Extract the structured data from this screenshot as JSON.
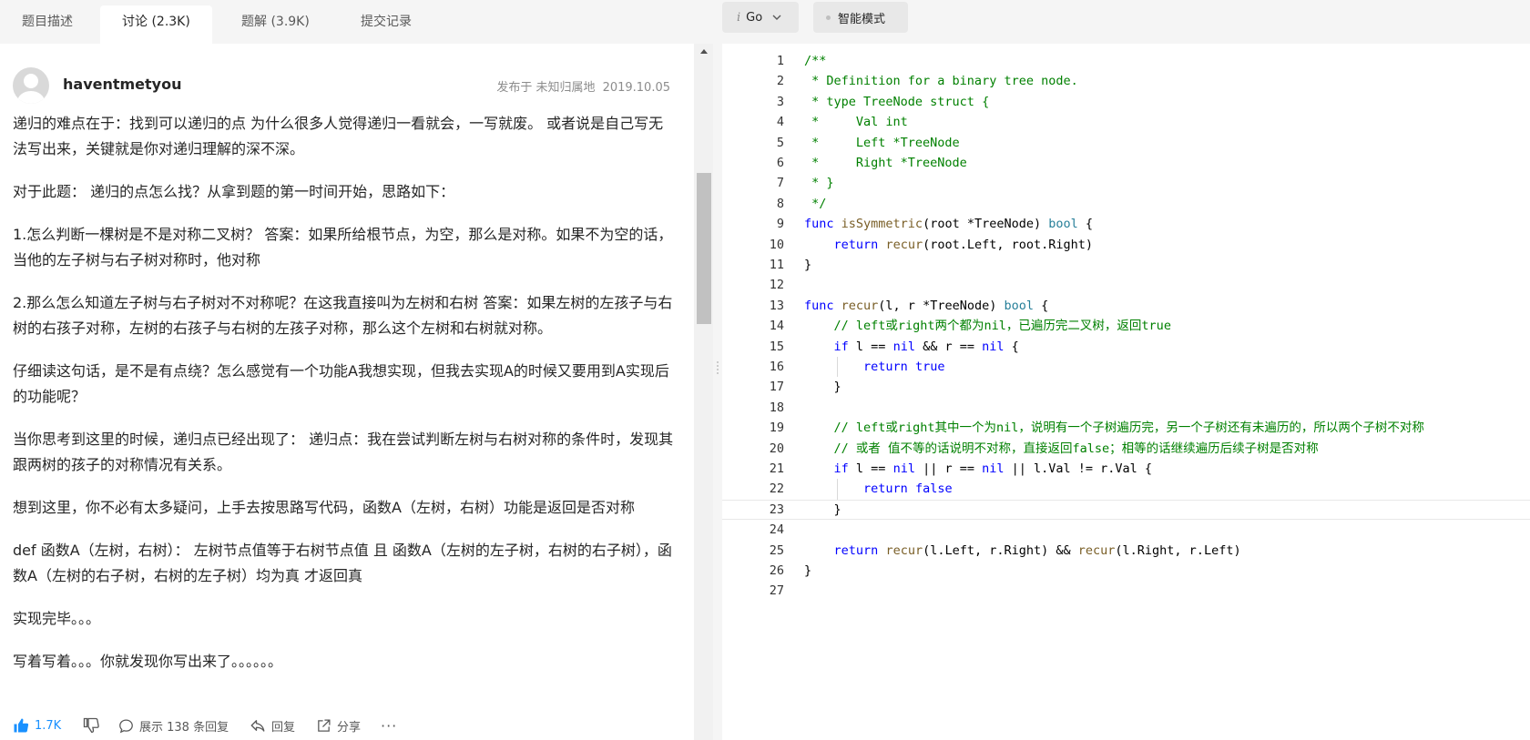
{
  "tabs": [
    {
      "label": "题目描述",
      "active": false
    },
    {
      "label": "讨论 (2.3K)",
      "active": true
    },
    {
      "label": "题解 (3.9K)",
      "active": false
    },
    {
      "label": "提交记录",
      "active": false
    }
  ],
  "post": {
    "author": "haventmetyou",
    "meta_prefix": "发布于 未知归属地",
    "date": "2019.10.05",
    "paragraphs": [
      "递归的难点在于：找到可以递归的点 为什么很多人觉得递归一看就会，一写就废。 或者说是自己写无法写出来，关键就是你对递归理解的深不深。",
      "对于此题： 递归的点怎么找？从拿到题的第一时间开始，思路如下：",
      "1.怎么判断一棵树是不是对称二叉树？ 答案：如果所给根节点，为空，那么是对称。如果不为空的话，当他的左子树与右子树对称时，他对称",
      "2.那么怎么知道左子树与右子树对不对称呢？在这我直接叫为左树和右树 答案：如果左树的左孩子与右树的右孩子对称，左树的右孩子与右树的左孩子对称，那么这个左树和右树就对称。",
      "仔细读这句话，是不是有点绕？怎么感觉有一个功能A我想实现，但我去实现A的时候又要用到A实现后的功能呢？",
      "当你思考到这里的时候，递归点已经出现了： 递归点：我在尝试判断左树与右树对称的条件时，发现其跟两树的孩子的对称情况有关系。",
      "想到这里，你不必有太多疑问，上手去按思路写代码，函数A（左树，右树）功能是返回是否对称",
      "def 函数A（左树，右树）： 左树节点值等于右树节点值 且 函数A（左树的左子树，右树的右子树），函数A（左树的右子树，右树的左子树）均为真 才返回真",
      "实现完毕。。。",
      "写着写着。。。你就发现你写出来了。。。。。。"
    ],
    "actions": {
      "like": "1.7K",
      "replies": "展示 138 条回复",
      "reply": "回复",
      "share": "分享",
      "more": "···"
    }
  },
  "toolbar": {
    "lang_icon": "i",
    "lang": "Go",
    "smart_mode": "智能模式"
  },
  "editor": {
    "current_line": 23,
    "lines": [
      [
        {
          "t": "/**",
          "c": "com"
        }
      ],
      [
        {
          "t": " * Definition for a binary tree node.",
          "c": "com"
        }
      ],
      [
        {
          "t": " * type TreeNode struct {",
          "c": "com"
        }
      ],
      [
        {
          "t": " *     Val int",
          "c": "com"
        }
      ],
      [
        {
          "t": " *     Left *TreeNode",
          "c": "com"
        }
      ],
      [
        {
          "t": " *     Right *TreeNode",
          "c": "com"
        }
      ],
      [
        {
          "t": " * }",
          "c": "com"
        }
      ],
      [
        {
          "t": " */",
          "c": "com"
        }
      ],
      [
        {
          "t": "func",
          "c": "kw"
        },
        {
          "t": " "
        },
        {
          "t": "isSymmetric",
          "c": "fn"
        },
        {
          "t": "(root *TreeNode) "
        },
        {
          "t": "bool",
          "c": "ty"
        },
        {
          "t": " {"
        }
      ],
      [
        {
          "t": "    "
        },
        {
          "t": "return",
          "c": "kw"
        },
        {
          "t": " "
        },
        {
          "t": "recur",
          "c": "fn"
        },
        {
          "t": "(root.Left, root.Right)"
        }
      ],
      [
        {
          "t": "}"
        }
      ],
      [],
      [
        {
          "t": "func",
          "c": "kw"
        },
        {
          "t": " "
        },
        {
          "t": "recur",
          "c": "fn"
        },
        {
          "t": "(l, r *TreeNode) "
        },
        {
          "t": "bool",
          "c": "ty"
        },
        {
          "t": " {"
        }
      ],
      [
        {
          "t": "    "
        },
        {
          "t": "// left或right两个都为nil，已遍历完二叉树，返回true",
          "c": "com"
        }
      ],
      [
        {
          "t": "    "
        },
        {
          "t": "if",
          "c": "kw"
        },
        {
          "t": " l == "
        },
        {
          "t": "nil",
          "c": "kw"
        },
        {
          "t": " && r == "
        },
        {
          "t": "nil",
          "c": "kw"
        },
        {
          "t": " {"
        }
      ],
      [
        {
          "t": "        "
        },
        {
          "t": "return",
          "c": "kw"
        },
        {
          "t": " "
        },
        {
          "t": "true",
          "c": "kw"
        }
      ],
      [
        {
          "t": "    }"
        }
      ],
      [],
      [
        {
          "t": "    "
        },
        {
          "t": "// left或right其中一个为nil，说明有一个子树遍历完，另一个子树还有未遍历的，所以两个子树不对称",
          "c": "com"
        }
      ],
      [
        {
          "t": "    "
        },
        {
          "t": "// 或者 值不等的话说明不对称，直接返回false；相等的话继续遍历后续子树是否对称",
          "c": "com"
        }
      ],
      [
        {
          "t": "    "
        },
        {
          "t": "if",
          "c": "kw"
        },
        {
          "t": " l == "
        },
        {
          "t": "nil",
          "c": "kw"
        },
        {
          "t": " || r == "
        },
        {
          "t": "nil",
          "c": "kw"
        },
        {
          "t": " || l.Val != r.Val {"
        }
      ],
      [
        {
          "t": "        "
        },
        {
          "t": "return",
          "c": "kw"
        },
        {
          "t": " "
        },
        {
          "t": "false",
          "c": "kw"
        }
      ],
      [
        {
          "t": "    }"
        }
      ],
      [],
      [
        {
          "t": "    "
        },
        {
          "t": "return",
          "c": "kw"
        },
        {
          "t": " "
        },
        {
          "t": "recur",
          "c": "fn"
        },
        {
          "t": "(l.Left, r.Right) && "
        },
        {
          "t": "recur",
          "c": "fn"
        },
        {
          "t": "(l.Right, r.Left)"
        }
      ],
      [
        {
          "t": "}"
        }
      ],
      []
    ]
  }
}
